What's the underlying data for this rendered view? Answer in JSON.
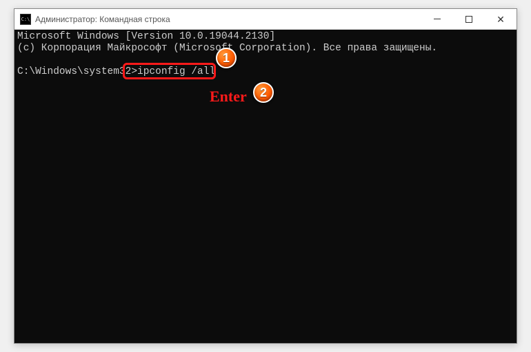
{
  "window": {
    "title": "Администратор: Командная строка"
  },
  "terminal": {
    "line1": "Microsoft Windows [Version 10.0.19044.2130]",
    "line2": "(c) Корпорация Майкрософт (Microsoft Corporation). Все права защищены.",
    "prompt": "C:\\Windows\\system32>",
    "command": "ipconfig /all"
  },
  "annotations": {
    "badge1": "1",
    "badge2": "2",
    "enter_label": "Enter"
  }
}
